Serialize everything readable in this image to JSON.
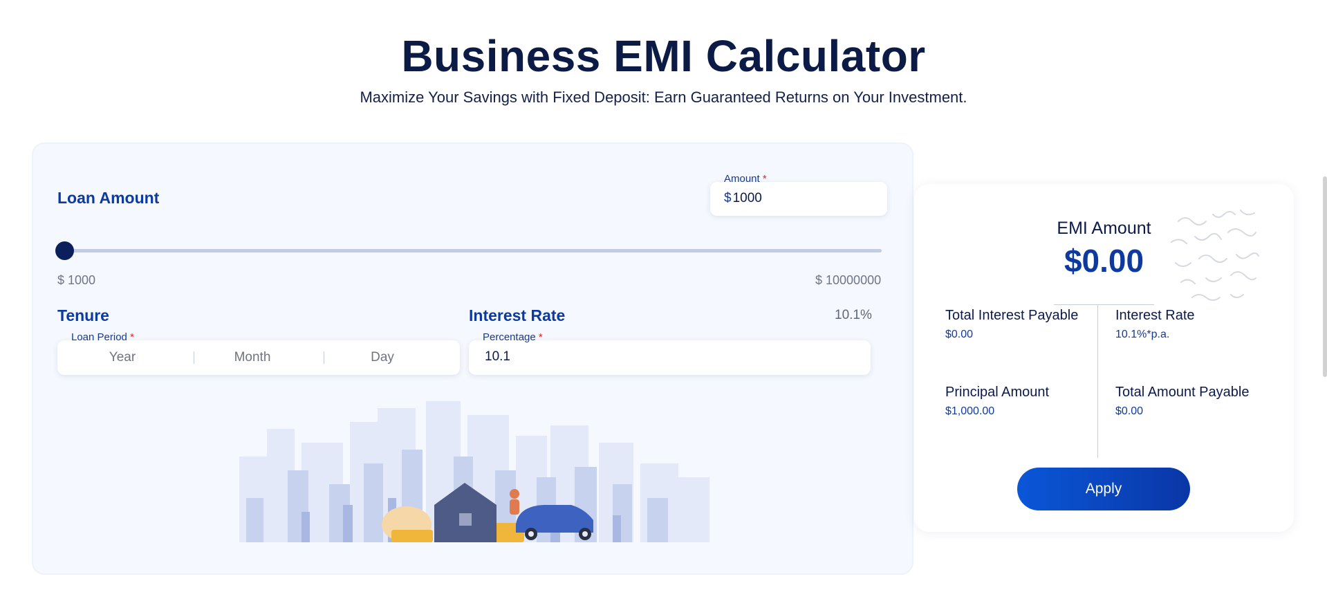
{
  "header": {
    "title": "Business EMI Calculator",
    "subtitle": "Maximize Your Savings with Fixed Deposit: Earn Guaranteed Returns on Your Investment."
  },
  "loan_amount": {
    "label": "Loan Amount",
    "field_legend": "Amount",
    "required_mark": "*",
    "currency": "$",
    "value": "1000",
    "slider": {
      "min_label": "$ 1000",
      "max_label": "$ 10000000",
      "value_fraction": 0.0
    }
  },
  "tenure": {
    "label": "Tenure",
    "field_legend": "Loan Period",
    "required_mark": "*",
    "segments": [
      "Year",
      "Month",
      "Day"
    ]
  },
  "interest": {
    "label": "Interest Rate",
    "display_value": "10.1%",
    "field_legend": "Percentage",
    "required_mark": "*",
    "value": "10.1"
  },
  "result": {
    "emi_label": "EMI Amount",
    "emi_value": "$0.00",
    "total_interest_label": "Total Interest Payable",
    "total_interest_value": "$0.00",
    "interest_rate_label": "Interest Rate",
    "interest_rate_value": "10.1%*p.a.",
    "principal_label": "Principal Amount",
    "principal_value": "$1,000.00",
    "total_payable_label": "Total Amount Payable",
    "total_payable_value": "$0.00",
    "apply_label": "Apply"
  },
  "colors": {
    "brand_dark": "#0c1a46",
    "brand_blue": "#0d3a9e",
    "button_gradient_start": "#0a57d8",
    "button_gradient_end": "#0a36a6",
    "panel_bg": "#f5f8fe"
  }
}
